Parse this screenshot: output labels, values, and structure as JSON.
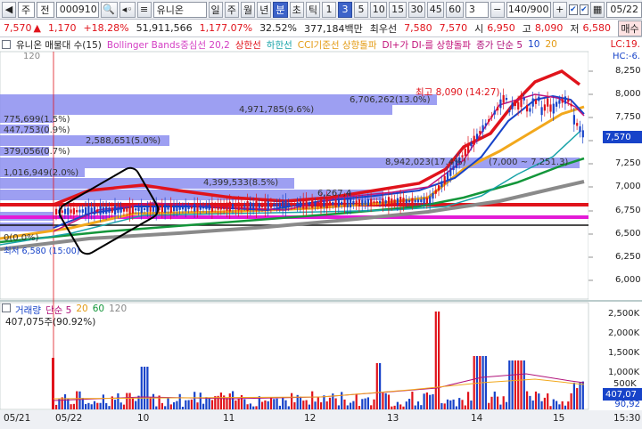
{
  "toolbar": {
    "market": "주",
    "type": "전",
    "code": "000910",
    "name": "유니온",
    "periods": [
      "일",
      "주",
      "월",
      "년",
      "분",
      "초",
      "틱"
    ],
    "active_period": "분",
    "intervals": [
      "1",
      "3",
      "5",
      "10",
      "15",
      "30",
      "45",
      "60"
    ],
    "active_interval": "3",
    "interval_value": "3",
    "count": "140/900",
    "date": "05/22"
  },
  "quote": {
    "price": "7,570",
    "change": "1,170",
    "change_pct": "+18.28%",
    "volume": "51,911,566",
    "volume_ratio": "1,177.07%",
    "turnover_pct": "32.52%",
    "amount": "377,184백만",
    "best_label": "최우선",
    "ask": "7,580",
    "bid": "7,570",
    "open_label": "시",
    "open": "6,950",
    "high_label": "고",
    "high": "8,090",
    "low_label": "저",
    "low": "6,580",
    "ask_tab": "매수"
  },
  "legend": {
    "name_ma": "유니온 매물대 수(15)",
    "bollinger": "Bollinger Bands중심선 20,2",
    "upper": "상한선",
    "lower": "하한선",
    "cci": "CCI기준선 상향돌파",
    "dmi": "DI+가 DI-를 상향돌파",
    "ma": "종가 단순 5",
    "ma10": "10",
    "ma20": "20",
    "lc": "LC:19.",
    "hc": "HC:-6.",
    "level120": "120"
  },
  "price_axis": [
    "8,250",
    "8,000",
    "7,750",
    "7,500",
    "7,250",
    "7,000",
    "6,750",
    "6,500",
    "6,250",
    "6,000"
  ],
  "price_tag": "7,570",
  "price_annotations": [
    {
      "text": "최고 8,090 (14:27)"
    },
    {
      "text": "6,706,262(13.0%)"
    },
    {
      "text": "4,971,785(9.6%)"
    },
    {
      "text": "775,699(1.5%)"
    },
    {
      "text": "447,753(0.9%)"
    },
    {
      "text": "2,588,651(5.0%)"
    },
    {
      "text": "379,056(0.7%)"
    },
    {
      "text": "8,942,023(17.4%)"
    },
    {
      "text": "(7,000 ~ 7,251.3)"
    },
    {
      "text": "1,016,949(2.0%)"
    },
    {
      "text": "4,399,533(8.5%)"
    },
    {
      "text": "6,267,4"
    },
    {
      "text": "0(0.0%)"
    },
    {
      "text": "최저 6,580 (15:00)"
    }
  ],
  "volume_panel": {
    "title": "거래량",
    "ma_label": "단순 5",
    "ma20": "20",
    "ma60": "60",
    "ma120": "120",
    "current": "407,075주(90.92%)",
    "axis": [
      "2,500K",
      "2,000K",
      "1,500K",
      "1,000K",
      "500K"
    ],
    "tag1": "407,07",
    "tag2": "90,92"
  },
  "time_axis": {
    "start": "05/21",
    "labels": [
      "05/22",
      "10",
      "11",
      "12",
      "13",
      "14",
      "15"
    ],
    "time": "15:30"
  },
  "colors": {
    "up": "#e0131b",
    "down": "#1743c9",
    "volume_profile": "#8c8ff0",
    "ma20": "#f2a81c",
    "ma60": "#13963a",
    "ma120": "#888888"
  }
}
